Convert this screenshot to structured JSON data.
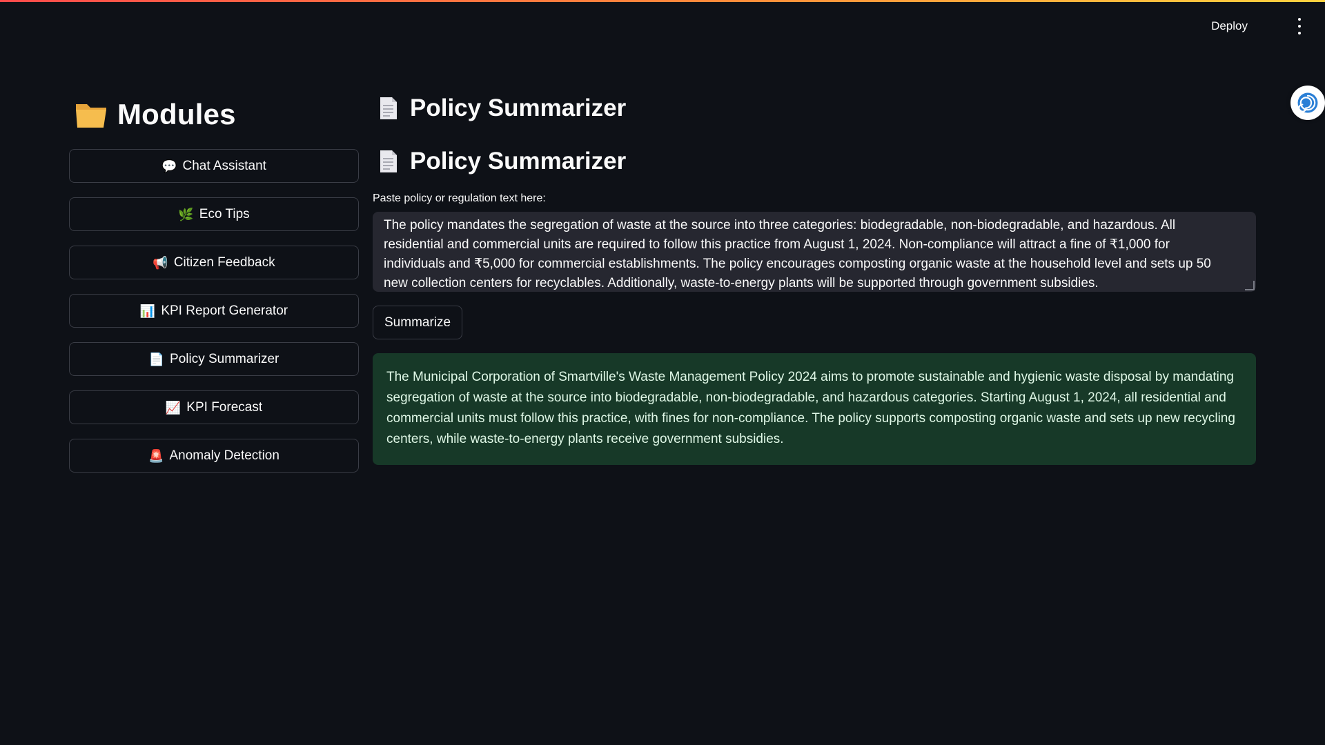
{
  "header": {
    "deploy_label": "Deploy",
    "menu_icon": "kebab-menu-icon",
    "assistant_icon": "swirl-assistant-icon"
  },
  "sidebar": {
    "title": "Modules",
    "title_icon": "folder-icon",
    "items": [
      {
        "icon": "💬",
        "label": "Chat Assistant"
      },
      {
        "icon": "🌿",
        "label": "Eco Tips"
      },
      {
        "icon": "📢",
        "label": "Citizen Feedback"
      },
      {
        "icon": "📊",
        "label": "KPI Report Generator"
      },
      {
        "icon": "📄",
        "label": "Policy Summarizer"
      },
      {
        "icon": "📈",
        "label": "KPI Forecast"
      },
      {
        "icon": "🚨",
        "label": "Anomaly Detection"
      }
    ]
  },
  "main": {
    "page_title": "Policy Summarizer",
    "section_title": "Policy Summarizer",
    "input_label": "Paste policy or regulation text here:",
    "input_value": "The policy mandates the segregation of waste at the source into three categories: biodegradable, non-biodegradable, and hazardous. All residential and commercial units are required to follow this practice from August 1, 2024. Non-compliance will attract a fine of ₹1,000 for individuals and ₹5,000 for commercial establishments. The policy encourages composting organic waste at the household level and sets up 50 new collection centers for recyclables. Additionally, waste-to-energy plants will be supported through government subsidies.",
    "summarize_label": "Summarize",
    "summary_text": "The Municipal Corporation of Smartville's Waste Management Policy 2024 aims to promote sustainable and hygienic waste disposal by mandating segregation of waste at the source into biodegradable, non-biodegradable, and hazardous categories. Starting August 1, 2024, all residential and commercial units must follow this practice, with fines for non-compliance. The policy supports composting organic waste and sets up new recycling centers, while waste-to-energy plants receive government subsidies."
  },
  "colors": {
    "background": "#0e1117",
    "input_bg": "#262730",
    "success_bg": "#173928",
    "accent_gradient_start": "#ff4b4b",
    "accent_gradient_end": "#ffd23f"
  }
}
